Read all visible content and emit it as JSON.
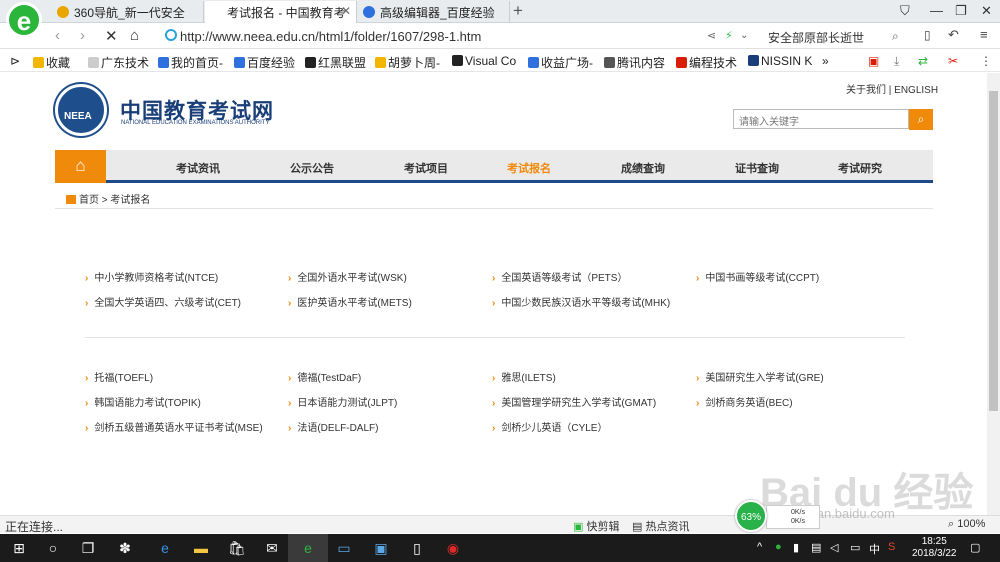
{
  "browser": {
    "logo_char": "e",
    "tabs": [
      {
        "label": "360导航_新一代安全",
        "active": false,
        "icon_color": "#e8a600"
      },
      {
        "label": "考试报名 - 中国教育考",
        "active": true,
        "icon_color": ""
      },
      {
        "label": "高级编辑器_百度经验",
        "active": false,
        "icon_color": "#2f6fde"
      }
    ],
    "new_tab": "+",
    "address_url": "http://www.neea.edu.cn/html1/folder/1607/298-1.htm",
    "search_text": "安全部原部长逝世",
    "bookmarks": [
      {
        "label": "收藏",
        "color": "#f2b600"
      },
      {
        "label": "广东技术",
        "color": "#cccccc"
      },
      {
        "label": "我的首页-",
        "color": "#2f6fde"
      },
      {
        "label": "百度经验",
        "color": "#2f6fde"
      },
      {
        "label": "红黑联盟",
        "color": "#222222"
      },
      {
        "label": "胡萝卜周-",
        "color": "#f2b600"
      },
      {
        "label": "Visual Co",
        "color": "#222222"
      },
      {
        "label": "收益广场-",
        "color": "#2f6fde"
      },
      {
        "label": "腾讯内容",
        "color": "#555555"
      },
      {
        "label": "编程技术",
        "color": "#d81e06"
      },
      {
        "label": "NISSIN K",
        "color": "#1a3e78"
      }
    ],
    "status_text": "正在连接...",
    "status_items": {
      "clip": "快剪辑",
      "hot": "热点资讯",
      "zoom": "100%"
    },
    "speed": {
      "percent": "63%",
      "up": "0K/s",
      "down": "0K/s"
    }
  },
  "site": {
    "logo_text": "NEEA",
    "name": "中国教育考试网",
    "name_en": "NATIONAL EDUCATION EXAMINATIONS AUTHORITY",
    "top_links": "关于我们  |  ENGLISH",
    "search_placeholder": "请输入关键字",
    "nav": [
      "考试资讯",
      "公示公告",
      "考试项目",
      "考试报名",
      "成绩查询",
      "证书查询",
      "考试研究"
    ],
    "nav_active": "考试报名",
    "breadcrumb": "首页 > 考试报名",
    "domestic_exams": [
      "中小学教师资格考试(NTCE)",
      "全国外语水平考试(WSK)",
      "全国英语等级考试（PETS）",
      "中国书画等级考试(CCPT)",
      "全国大学英语四、六级考试(CET)",
      "医护英语水平考试(METS)",
      "中国少数民族汉语水平等级考试(MHK)"
    ],
    "foreign_exams": [
      "托福(TOEFL)",
      "德福(TestDaF)",
      "雅思(ILETS)",
      "美国研究生入学考试(GRE)",
      "韩国语能力考试(TOPIK)",
      "日本语能力测试(JLPT)",
      "美国管理学研究生入学考试(GMAT)",
      "剑桥商务英语(BEC)",
      "剑桥五级普通英语水平证书考试(MSE)",
      "法语(DELF-DALF)",
      "剑桥少儿英语（CYLE）"
    ]
  },
  "watermark": {
    "main": "Bai du 经验",
    "sub": "jingyan.baidu.com"
  },
  "taskbar": {
    "time": "18:25",
    "date": "2018/3/22",
    "ime": "中"
  }
}
